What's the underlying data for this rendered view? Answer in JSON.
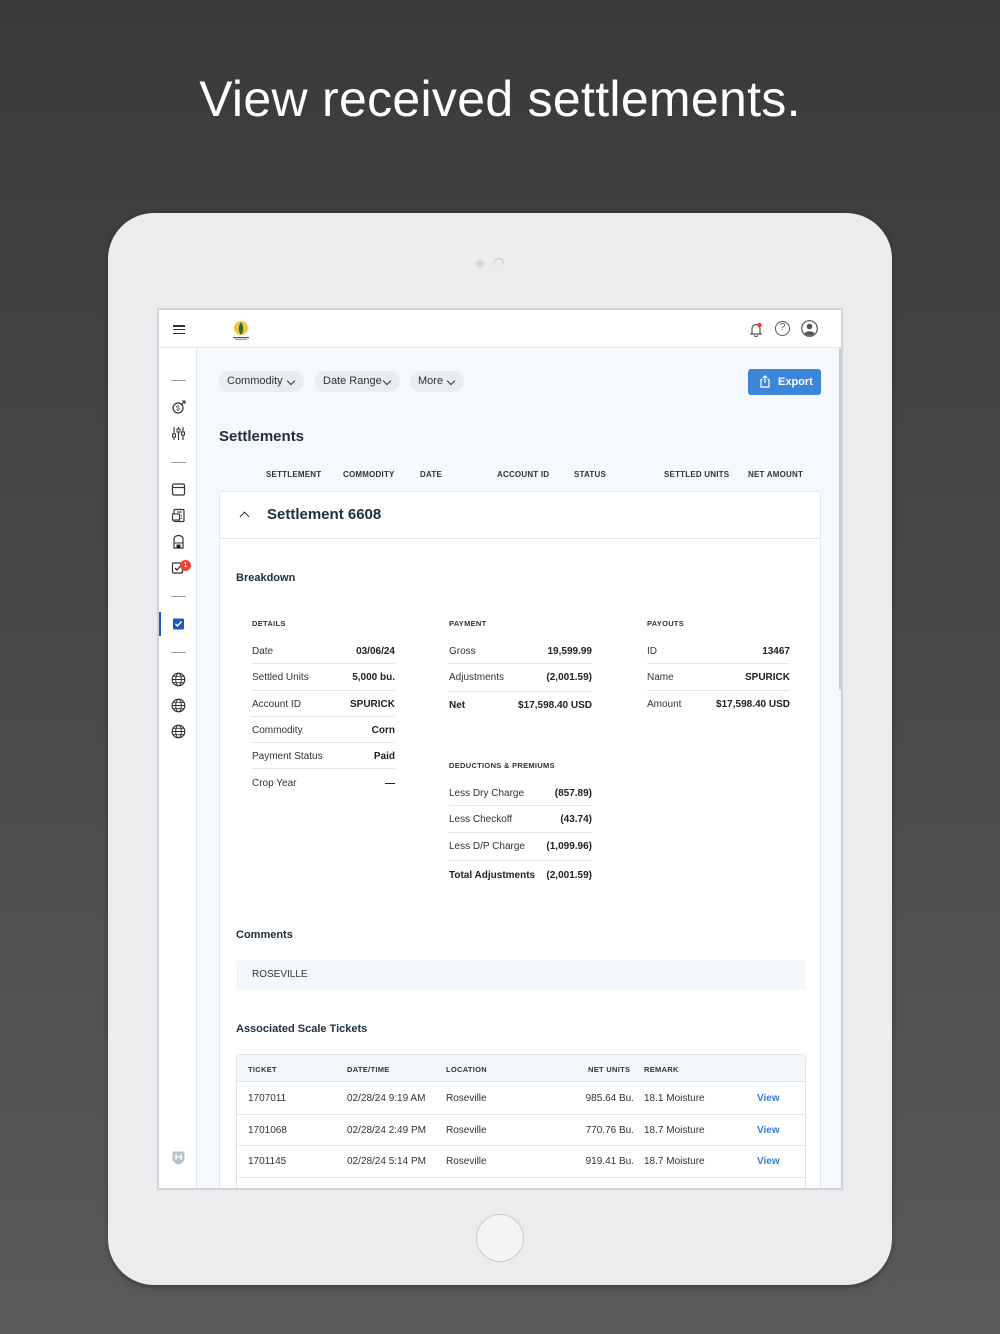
{
  "headline": "View received settlements.",
  "filters": {
    "commodity": "Commodity",
    "date_range": "Date Range",
    "more": "More",
    "export": "Export"
  },
  "page_title": "Settlements",
  "columns": [
    "SETTLEMENT",
    "COMMODITY",
    "DATE",
    "ACCOUNT ID",
    "STATUS",
    "SETTLED UNITS",
    "NET AMOUNT"
  ],
  "settlement": {
    "title": "Settlement 6608",
    "breakdown_title": "Breakdown",
    "details_label": "DETAILS",
    "details": [
      {
        "k": "Date",
        "v": "03/06/24"
      },
      {
        "k": "Settled Units",
        "v": "5,000 bu."
      },
      {
        "k": "Account ID",
        "v": "SPURICK"
      },
      {
        "k": "Commodity",
        "v": "Corn"
      },
      {
        "k": "Payment Status",
        "v": "Paid"
      },
      {
        "k": "Crop Year",
        "v": "—"
      }
    ],
    "payment_label": "PAYMENT",
    "payment": [
      {
        "k": "Gross",
        "v": "19,599.99"
      },
      {
        "k": "Adjustments",
        "v": "(2,001.59)"
      },
      {
        "k": "Net",
        "v": "$17,598.40 USD"
      }
    ],
    "payouts_label": "PAYOUTS",
    "payouts": [
      {
        "k": "ID",
        "v": "13467"
      },
      {
        "k": "Name",
        "v": "SPURICK"
      },
      {
        "k": "Amount",
        "v": "$17,598.40 USD"
      }
    ],
    "deductions_label": "DEDUCTIONS & PREMIUMS",
    "deductions": [
      {
        "k": "Less Dry Charge",
        "v": "(857.89)"
      },
      {
        "k": "Less Checkoff",
        "v": "(43.74)"
      },
      {
        "k": "Less D/P Charge",
        "v": "(1,099.96)"
      },
      {
        "k": "Total Adjustments",
        "v": "(2,001.59)"
      }
    ],
    "comments_title": "Comments",
    "comment": "ROSEVILLE",
    "tickets_title": "Associated Scale Tickets",
    "ticket_columns": [
      "TICKET",
      "DATE/TIME",
      "LOCATION",
      "NET UNITS",
      "REMARK"
    ],
    "tickets": [
      {
        "ticket": "1707011",
        "datetime": "02/28/24 9:19 AM",
        "location": "Roseville",
        "net_units": "985.64 Bu.",
        "remark": "18.1 Moisture",
        "action": "View"
      },
      {
        "ticket": "1701068",
        "datetime": "02/28/24 2:49 PM",
        "location": "Roseville",
        "net_units": "770.76 Bu.",
        "remark": "18.7 Moisture",
        "action": "View"
      },
      {
        "ticket": "1701145",
        "datetime": "02/28/24 5:14 PM",
        "location": "Roseville",
        "net_units": "919.41 Bu.",
        "remark": "18.7 Moisture",
        "action": "View"
      }
    ]
  },
  "notification_count": "1",
  "colors": {
    "accent": "#3d85d8",
    "badge": "#e8453c",
    "active": "#1e5bb8"
  }
}
